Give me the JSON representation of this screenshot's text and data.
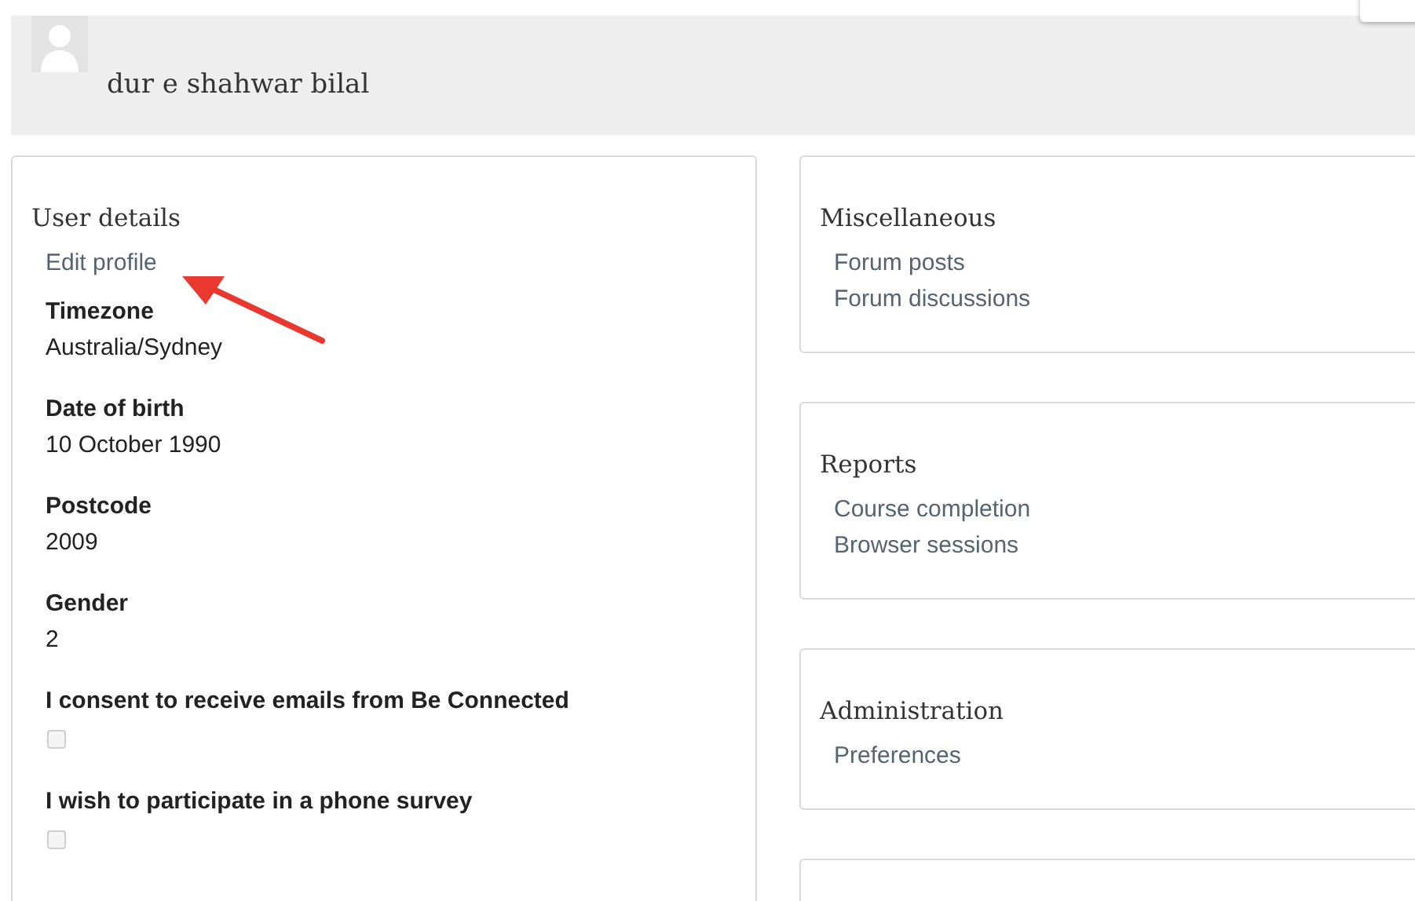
{
  "header": {
    "user_name": "dur e shahwar bilal"
  },
  "user_details": {
    "title": "User details",
    "edit_link": "Edit profile",
    "fields": [
      {
        "kind": "text",
        "label": "Timezone",
        "value": "Australia/Sydney"
      },
      {
        "kind": "text",
        "label": "Date of birth",
        "value": "10 October 1990"
      },
      {
        "kind": "text",
        "label": "Postcode",
        "value": "2009"
      },
      {
        "kind": "text",
        "label": "Gender",
        "value": "2"
      },
      {
        "kind": "checkbox",
        "label": "I consent to receive emails from Be Connected",
        "checked": false,
        "disabled": true
      },
      {
        "kind": "checkbox",
        "label": "I wish to participate in a phone survey",
        "checked": false,
        "disabled": true
      }
    ]
  },
  "sections": [
    {
      "title": "Miscellaneous",
      "links": [
        "Forum posts",
        "Forum discussions"
      ]
    },
    {
      "title": "Reports",
      "links": [
        "Course completion",
        "Browser sessions"
      ]
    },
    {
      "title": "Administration",
      "links": [
        "Preferences"
      ]
    }
  ]
}
